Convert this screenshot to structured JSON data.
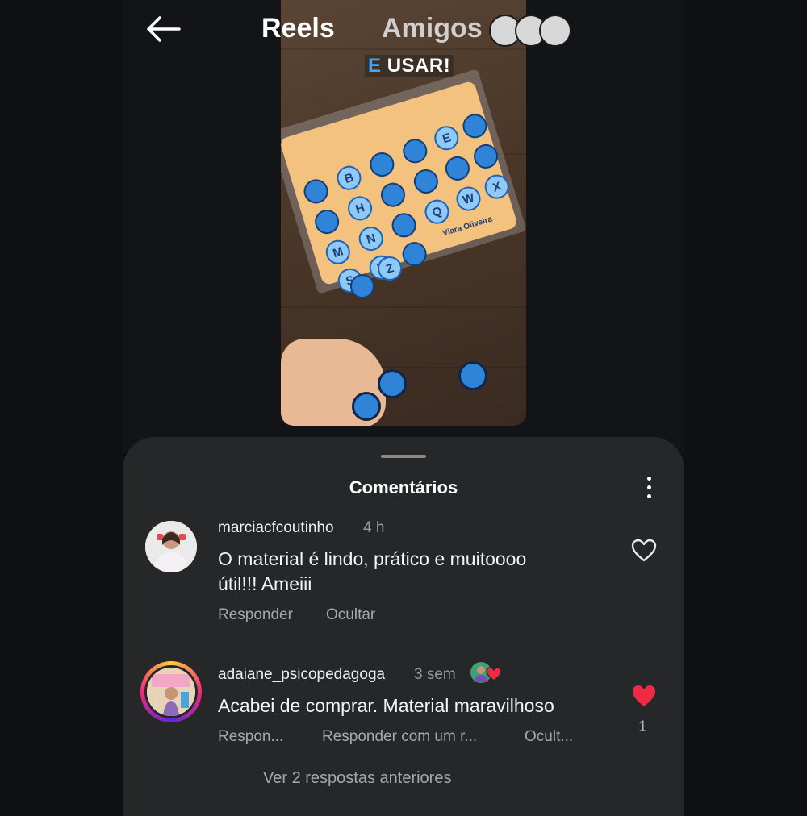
{
  "header": {
    "back_icon": "arrow-left-icon",
    "tabs": [
      {
        "label": "Reels",
        "active": true
      },
      {
        "label": "Amigos",
        "active": false
      }
    ],
    "friends_avatars_icon": "stacked-avatars-icon"
  },
  "video": {
    "caption_accent": "E",
    "caption_rest": "USAR!",
    "board_letters": [
      "B",
      "E",
      "H",
      "Q",
      "M",
      "N",
      "W",
      "X",
      "S",
      "T",
      "Z"
    ],
    "brand_text": "Viara Oliveira",
    "accent_color": "#3fa7ff"
  },
  "comments_sheet": {
    "title": "Comentários",
    "more_icon": "more-vertical-icon",
    "comments": [
      {
        "username": "marciacfcoutinho",
        "time": "4 h",
        "text_line1": "O material é lindo, prático e muitoooo",
        "text_line2": "útil!!! Ameiii",
        "actions": [
          "Responder",
          "Ocultar"
        ],
        "liked": false,
        "like_icon": "heart-outline-icon"
      },
      {
        "username": "adaiane_psicopedagoga",
        "time": "3 sem",
        "creator_liked_icon": "creator-liked-heart-icon",
        "text": "Acabei de comprar. Material maravilhoso",
        "actions": [
          "Respon...",
          "Responder com um r...",
          "Ocult..."
        ],
        "liked": true,
        "like_icon": "heart-filled-icon",
        "like_count": "1",
        "like_color": "#ed2c43"
      }
    ],
    "view_replies": "Ver 2 respostas anteriores"
  }
}
